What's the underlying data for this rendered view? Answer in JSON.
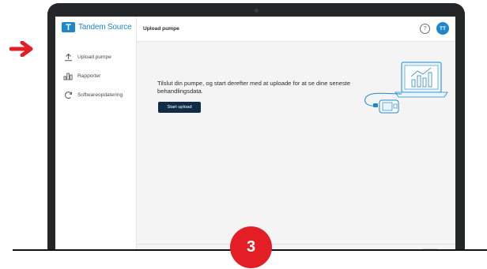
{
  "brand": {
    "name": "Tandem Source",
    "accent": "#1e88c9",
    "dark_button": "#102d48",
    "callout_red": "#e31e25"
  },
  "sidebar": {
    "items": [
      {
        "label": "Upload pumpe",
        "icon": "upload-icon"
      },
      {
        "label": "Rapporter",
        "icon": "reports-icon"
      },
      {
        "label": "Softwareopdatering",
        "icon": "refresh-icon"
      }
    ]
  },
  "header": {
    "title": "Upload pumpe",
    "help_icon": "help-icon",
    "avatar_initials": "TT"
  },
  "main": {
    "instruction": "Tilslut din pumpe, og start derefter med at uploade for at se dine seneste behandlingsdata.",
    "start_button": "Start upload",
    "illustration": "pump-to-laptop-icon"
  },
  "callout": {
    "step_number": "3",
    "arrow_icon": "arrow-right-icon"
  }
}
